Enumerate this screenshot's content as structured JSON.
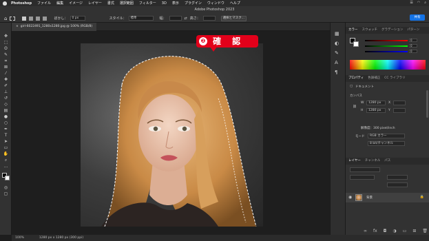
{
  "menubar": {
    "app": "Photoshop",
    "items": [
      "ファイル",
      "編集",
      "イメージ",
      "レイヤー",
      "書式",
      "選択範囲",
      "フィルター",
      "3D",
      "表示",
      "プラグイン",
      "ウィンドウ",
      "ヘルプ"
    ]
  },
  "window": {
    "title": "Adobe Photoshop 2023"
  },
  "options": {
    "feather_label": "ぼかし：",
    "feather_value": "0 px",
    "style_label": "スタイル：",
    "style_value": "標準",
    "width_label": "幅：",
    "height_label": "高さ：",
    "select_mask_label": "選択とマスク...",
    "share_label": "共有"
  },
  "document": {
    "tab_label": "girl-6022491_1280x1280.jpg @ 100% (RGB/8)",
    "zoom": "100%",
    "doc_info": "1280 px x 1280 px (300 ppi)"
  },
  "callout": {
    "number": "❷",
    "text": "確 認"
  },
  "color_panel": {
    "tabs": [
      "カラー",
      "スウォッチ",
      "グラデーション",
      "パターン"
    ],
    "slider_values": [
      "0",
      "0",
      "0"
    ]
  },
  "properties_panel": {
    "tabs": [
      "プロパティ",
      "色調補正",
      "CC ライブラリ"
    ],
    "doc_label": "ドキュメント",
    "canvas_label": "カンバス",
    "w_label": "W",
    "w_value": "1280 px",
    "h_label": "H",
    "h_value": "1280 px",
    "x_label": "X",
    "y_label": "Y",
    "resolution": "解像度：300 pixel/inch",
    "mode_label": "モード",
    "mode_value": "RGB カラー",
    "depth_value": "8 bit/チャンネル"
  },
  "layers_panel": {
    "tabs": [
      "レイヤー",
      "チャンネル",
      "パス"
    ],
    "layer_name": "背景"
  },
  "colors": {
    "accent": "#1473e6",
    "callout": "#e2001a"
  }
}
